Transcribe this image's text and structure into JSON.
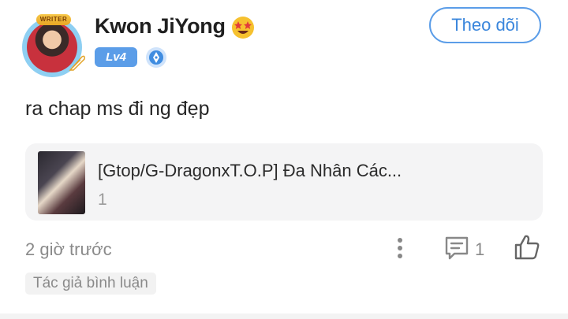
{
  "comment": {
    "user": {
      "name": "Kwon JiYong",
      "emoji": "star-struck-emoji-icon",
      "avatar_badge": "WRITER",
      "level": "Lv4",
      "role_badge": "pen-badge-icon"
    },
    "follow_label": "Theo dõi",
    "text": "ra chap ms đi ng đẹp",
    "story": {
      "title": "[Gtop/G-DragonxT.O.P] Đa Nhân Các...",
      "count": "1"
    },
    "time": "2 giờ trước",
    "reply_count": "1",
    "author_tag": "Tác giả bình luận"
  },
  "colors": {
    "accent": "#5b9de8",
    "card_bg": "#f4f4f5",
    "muted_text": "#8a8a8a"
  }
}
